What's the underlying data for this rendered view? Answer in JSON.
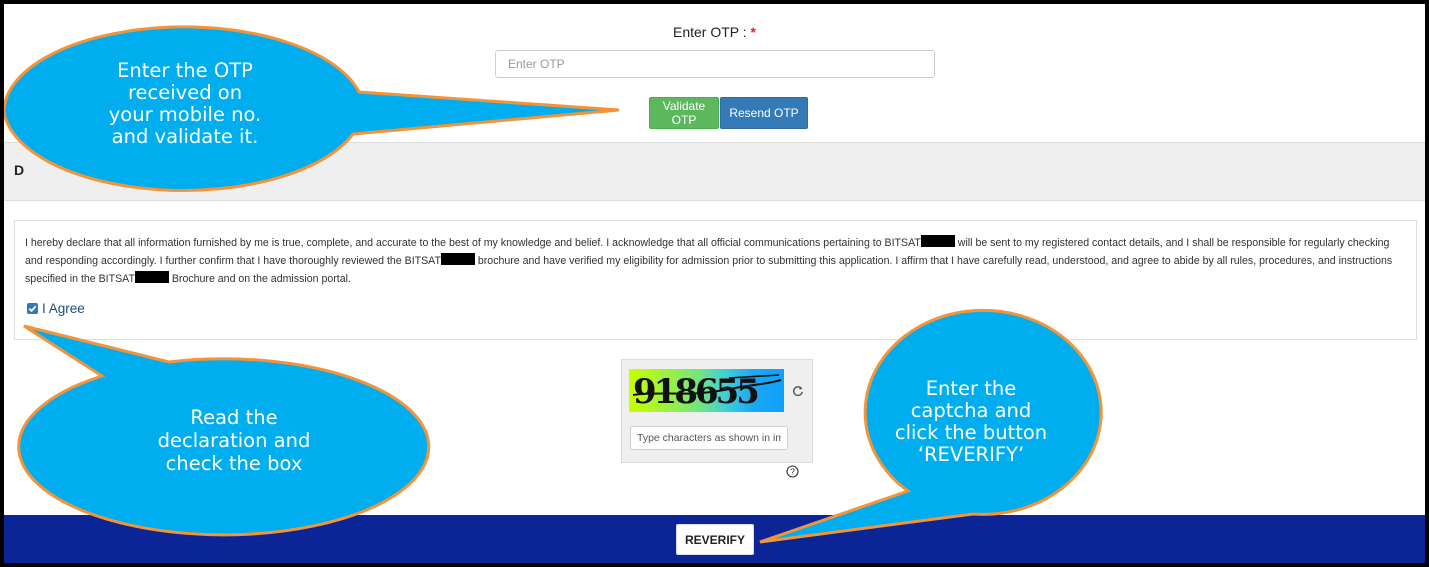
{
  "otp": {
    "label": "Enter OTP :",
    "required_marker": "*",
    "placeholder": "Enter OTP",
    "validate_label": "Validate OTP",
    "resend_label": "Resend OTP"
  },
  "section_bar": {
    "visible_text": "D"
  },
  "declaration": {
    "part1": "I hereby declare that all information furnished by me is true, complete, and accurate to the best of my knowledge and belief. I acknowledge that all official communications pertaining to BITSAT",
    "part2": " will be sent to my registered contact details, and I shall be responsible for regularly checking and responding accordingly. I further confirm that I have thoroughly reviewed the BITSAT",
    "part3": " brochure and have verified my eligibility for admission prior to submitting this application. I affirm that I have carefully read, understood, and agree to abide by all rules, procedures, and instructions specified in the BITSAT",
    "part4": " Brochure and on the admission portal.",
    "agree_label": "I Agree",
    "agree_checked": true
  },
  "captcha": {
    "value": "918655",
    "placeholder": "Type characters as shown in image",
    "help_icon": "help-circle-icon",
    "refresh_icon": "refresh-icon"
  },
  "footer": {
    "reverify_label": "REVERIFY"
  },
  "callouts": {
    "otp": [
      "Enter the OTP",
      "received on",
      "your mobile no.",
      "and validate it."
    ],
    "declaration": [
      "Read the",
      "declaration and",
      "check the box"
    ],
    "captcha": [
      "Enter the",
      "captcha and",
      "click the button",
      "‘REVERIFY’"
    ]
  },
  "colors": {
    "validate_button": "#5cb85c",
    "resend_button": "#337ab7",
    "footer_bar": "#0b2596",
    "callout_fill": "#00aeef",
    "callout_border": "#f3943a",
    "required": "#d9232d"
  }
}
